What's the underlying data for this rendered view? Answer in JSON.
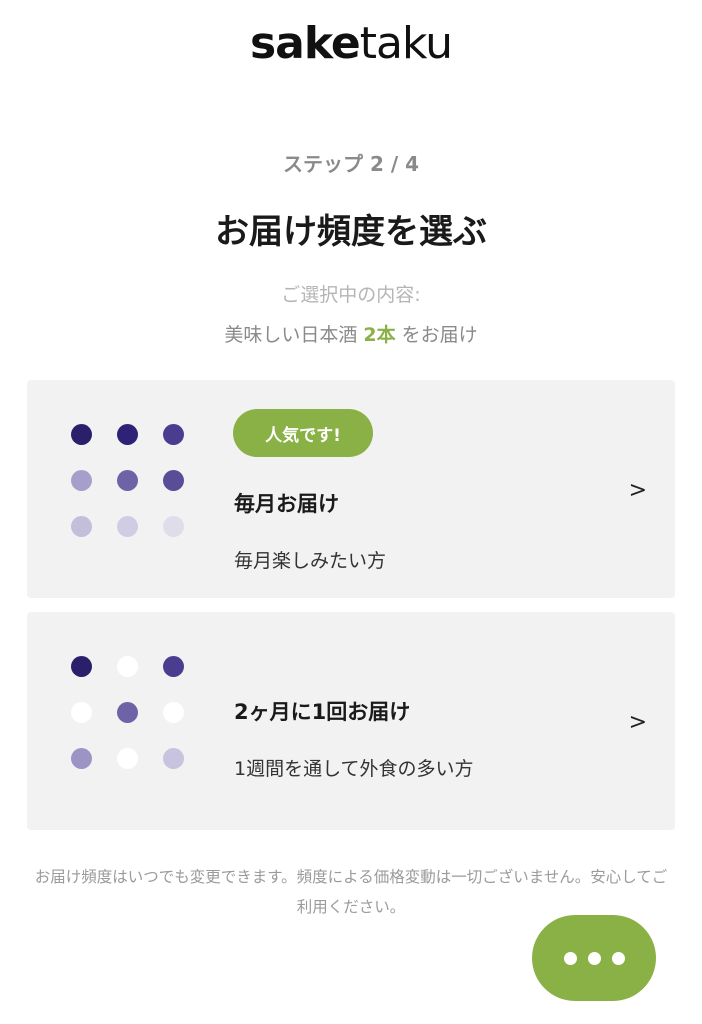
{
  "header": {
    "logo_bold": "sake",
    "logo_light": "taku"
  },
  "step": {
    "label": "ステップ 2 / 4"
  },
  "page": {
    "title": "お届け頻度を選ぶ"
  },
  "selection": {
    "label": "ご選択中の内容:",
    "prefix": "美味しい日本酒 ",
    "count": "2本",
    "suffix": " をお届け"
  },
  "options": [
    {
      "badge": "人気です!",
      "title": "毎月お届け",
      "description": "毎月楽しみたい方",
      "arrow": ">",
      "dot_colors": [
        "#2a1f6b",
        "#2e2277",
        "#4a3d8f",
        "#a79fcb",
        "#6f63a8",
        "#5a4d98",
        "#c4bedd",
        "#d0cce4",
        "#e0ddeb"
      ]
    },
    {
      "title": "2ヶ月に1回お届け",
      "description": "1週間を通して外食の多い方",
      "arrow": ">",
      "dot_colors": [
        "#2a1f6b",
        "#ffffff",
        "#4a3d8f",
        "#ffffff",
        "#6f63a8",
        "#ffffff",
        "#9c94c4",
        "#ffffff",
        "#c8c3de"
      ]
    }
  ],
  "footer": {
    "note": "お届け頻度はいつでも変更できます。頻度による価格変動は一切ございません。安心してご利用ください。"
  },
  "colors": {
    "accent": "#8ab146",
    "card_bg": "#f2f2f2"
  },
  "chat_button": {
    "icon": "more-dots-icon"
  }
}
